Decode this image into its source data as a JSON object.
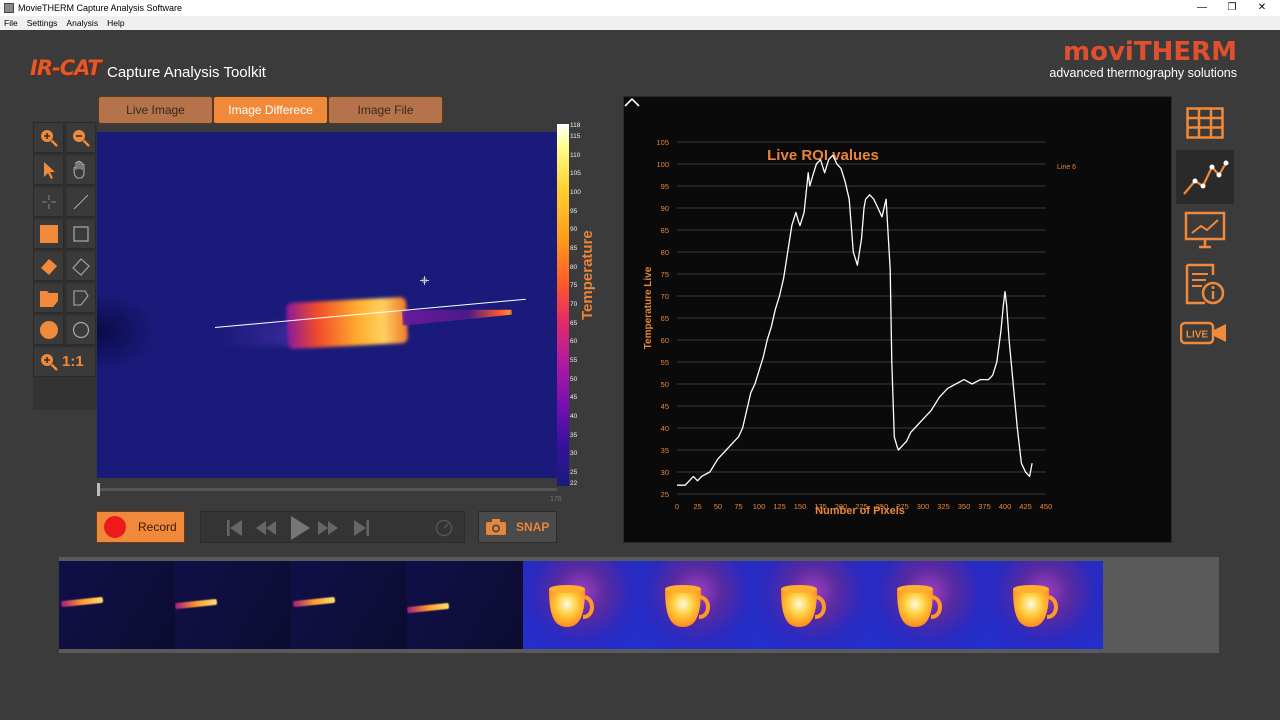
{
  "window": {
    "title": "MovieTHERM Capture Analysis Software"
  },
  "menu": [
    "File",
    "Settings",
    "Analysis",
    "Help"
  ],
  "header": {
    "logo_text": "IR-CAT",
    "subtitle": "Capture Analysis Toolkit",
    "brand_name": "moviTHERM",
    "brand_tagline": "advanced thermography solutions"
  },
  "tabs": [
    {
      "label": "Live Image",
      "active": false
    },
    {
      "label": "Image Differece",
      "active": true
    },
    {
      "label": "Image File",
      "active": false
    }
  ],
  "toolbar": {
    "tools": [
      "zoom-in",
      "zoom-out",
      "pointer",
      "pan-hand",
      "crosshair",
      "line",
      "filled-rectangle",
      "rectangle",
      "filled-eraser",
      "eraser",
      "filled-polygon",
      "polygon",
      "filled-circle",
      "circle"
    ],
    "zoom_reset_label": "1:1"
  },
  "colorbar": {
    "title": "Temperature",
    "ticks": [
      "118",
      "115",
      "110",
      "105",
      "100",
      "95",
      "90",
      "85",
      "80",
      "75",
      "70",
      "65",
      "60",
      "55",
      "50",
      "45",
      "40",
      "35",
      "30",
      "25",
      "22"
    ],
    "max": 118,
    "min": 22
  },
  "scrubber": {
    "end_label": "176"
  },
  "controls": {
    "record_label": "Record",
    "snap_label": "SNAP"
  },
  "side_panel": {
    "icons": [
      "table-icon",
      "line-chart-icon",
      "monitor-chart-icon",
      "report-info-icon",
      "live-camera-icon"
    ],
    "live_label": "LIVE"
  },
  "colors": {
    "accent": "#f08a3a",
    "brand": "#e0502e",
    "chart_line": "#ffffff",
    "chart_text": "#e8853a"
  },
  "chart_data": {
    "type": "line",
    "title": "Live ROI values",
    "legend": "Line 6",
    "xlabel": "Number of Pixels",
    "ylabel": "Temperature Live",
    "xlim": [
      0,
      450
    ],
    "ylim": [
      25,
      105
    ],
    "xticks": [
      0,
      25,
      50,
      75,
      100,
      125,
      150,
      175,
      200,
      225,
      250,
      275,
      300,
      325,
      350,
      375,
      400,
      425,
      450
    ],
    "yticks": [
      25,
      30,
      35,
      40,
      45,
      50,
      55,
      60,
      65,
      70,
      75,
      80,
      85,
      90,
      95,
      100,
      105
    ],
    "grid": "horizontal",
    "series": [
      {
        "name": "Line 6",
        "x": [
          0,
          10,
          15,
          20,
          25,
          30,
          40,
          50,
          55,
          60,
          70,
          75,
          80,
          85,
          90,
          95,
          100,
          105,
          110,
          115,
          120,
          125,
          130,
          135,
          140,
          145,
          148,
          150,
          155,
          160,
          162,
          165,
          170,
          175,
          180,
          185,
          190,
          195,
          200,
          205,
          210,
          215,
          220,
          225,
          228,
          230,
          235,
          240,
          245,
          250,
          255,
          260,
          262,
          265,
          268,
          270,
          275,
          280,
          285,
          290,
          300,
          310,
          320,
          330,
          340,
          350,
          360,
          370,
          380,
          385,
          390,
          395,
          398,
          400,
          402,
          405,
          410,
          415,
          420,
          425,
          430,
          433
        ],
        "y": [
          27,
          27,
          28,
          29,
          28,
          29,
          30,
          33,
          34,
          35,
          37,
          38,
          40,
          44,
          48,
          50,
          53,
          56,
          60,
          63,
          67,
          70,
          74,
          80,
          86,
          89,
          87,
          86,
          89,
          98,
          95,
          97,
          100,
          101,
          98,
          101,
          102,
          100,
          99,
          96,
          92,
          80,
          77,
          83,
          90,
          92,
          93,
          92,
          90,
          88,
          92,
          76,
          55,
          38,
          36,
          35,
          36,
          37,
          39,
          40,
          42,
          44,
          47,
          49,
          50,
          51,
          50,
          51,
          51,
          52,
          55,
          62,
          68,
          71,
          68,
          60,
          50,
          40,
          32,
          30,
          29,
          32
        ]
      }
    ]
  }
}
